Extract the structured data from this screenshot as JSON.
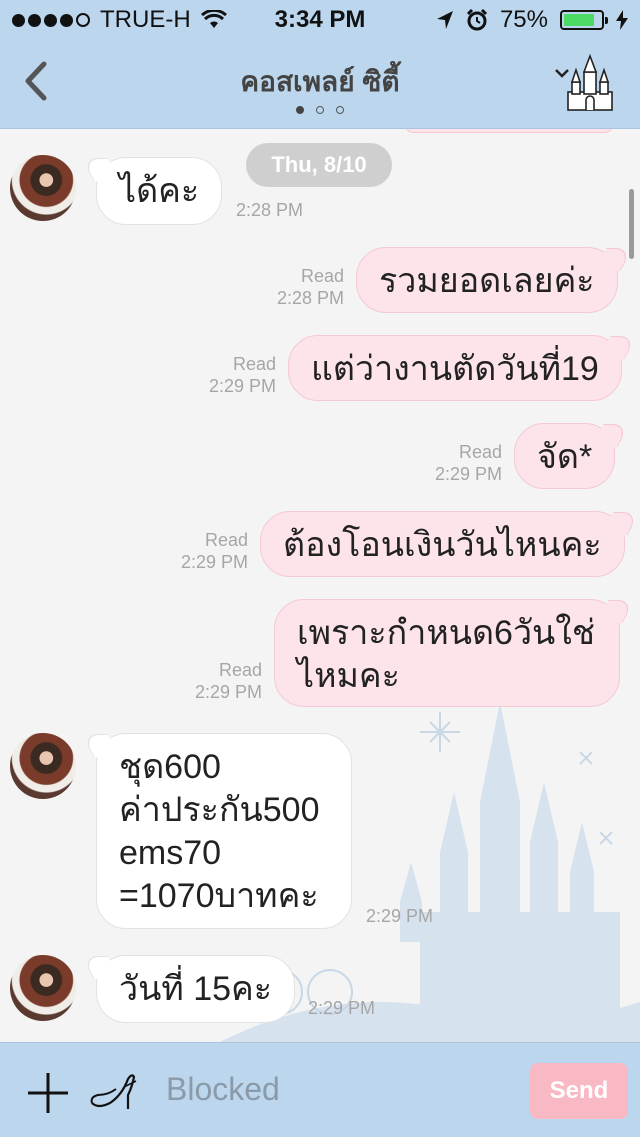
{
  "status_bar": {
    "carrier": "TRUE-H",
    "time": "3:34 PM",
    "battery": "75%",
    "battery_level": 0.75,
    "signal_bars_filled": 4
  },
  "header": {
    "title": "คอสเพลย์ ซิตี้"
  },
  "chat": {
    "date_pill": "Thu, 8/10",
    "messages": [
      {
        "text": "ได้คะ",
        "time": "2:28 PM"
      },
      {
        "text": "รวมยอดเลยค่ะ",
        "read": "Read",
        "time": "2:28 PM"
      },
      {
        "text": "แต่ว่างานตัดวันที่19",
        "read": "Read",
        "time": "2:29 PM"
      },
      {
        "text": "จัด*",
        "read": "Read",
        "time": "2:29 PM"
      },
      {
        "text": "ต้องโอนเงินวันไหนคะ",
        "read": "Read",
        "time": "2:29 PM"
      },
      {
        "text": "เพราะกำหนด6วันใช่\nไหมคะ",
        "read": "Read",
        "time": "2:29 PM"
      },
      {
        "text": "ชุด600\nค่าประกัน500\nems70\n=1070บาทคะ",
        "time": "2:29 PM"
      },
      {
        "text": "วันที่ 15คะ",
        "time": "2:29 PM"
      }
    ]
  },
  "input_bar": {
    "placeholder": "Blocked",
    "send_label": "Send"
  },
  "colors": {
    "bar": "#bcd6ee",
    "outgoing": "#fde4ea",
    "incoming": "#ffffff",
    "send": "#f8b9c5"
  }
}
